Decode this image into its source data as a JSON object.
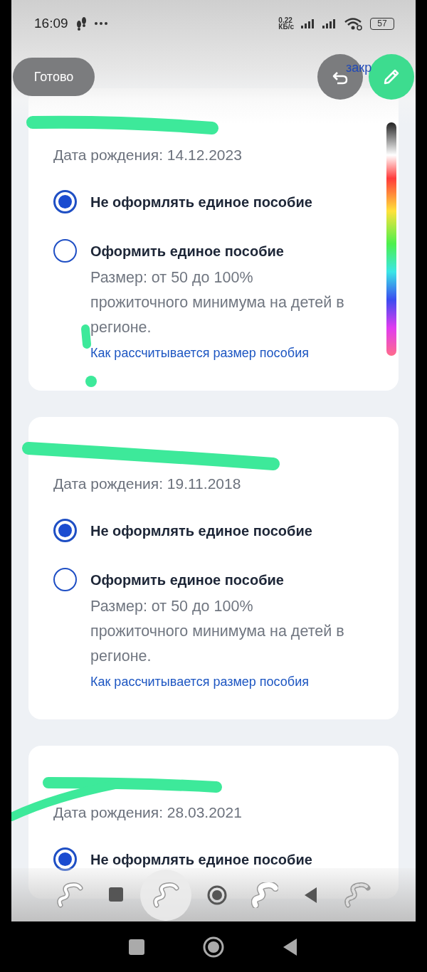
{
  "status_bar": {
    "time": "16:09",
    "speed_value": "0.22",
    "speed_unit": "КБ/с",
    "battery": "57"
  },
  "top_bar": {
    "done_button": "Готово",
    "close_link": "закр"
  },
  "child_cards": [
    {
      "birth_date": "Дата рождения: 14.12.2023",
      "options": [
        {
          "label": "Не оформлять единое пособие",
          "selected": true
        },
        {
          "label": "Оформить единое пособие",
          "selected": false,
          "description": "Размер: от 50 до 100% прожиточного минимума на детей в регионе.",
          "link": "Как рассчитывается размер пособия"
        }
      ]
    },
    {
      "birth_date": "Дата рождения: 19.11.2018",
      "options": [
        {
          "label": "Не оформлять единое пособие",
          "selected": true
        },
        {
          "label": "Оформить единое пособие",
          "selected": false,
          "description": "Размер: от 50 до 100% прожиточного минимума на детей в регионе.",
          "link": "Как рассчитывается размер пособия"
        }
      ]
    },
    {
      "birth_date": "Дата рождения: 28.03.2021",
      "options": [
        {
          "label": "Не оформлять единое пособие",
          "selected": true
        }
      ]
    }
  ],
  "drawing_tools": [
    {
      "kind": "pen",
      "selected": false
    },
    {
      "kind": "pen",
      "selected": true
    },
    {
      "kind": "marker",
      "selected": false
    },
    {
      "kind": "mosaic",
      "selected": false
    }
  ]
}
